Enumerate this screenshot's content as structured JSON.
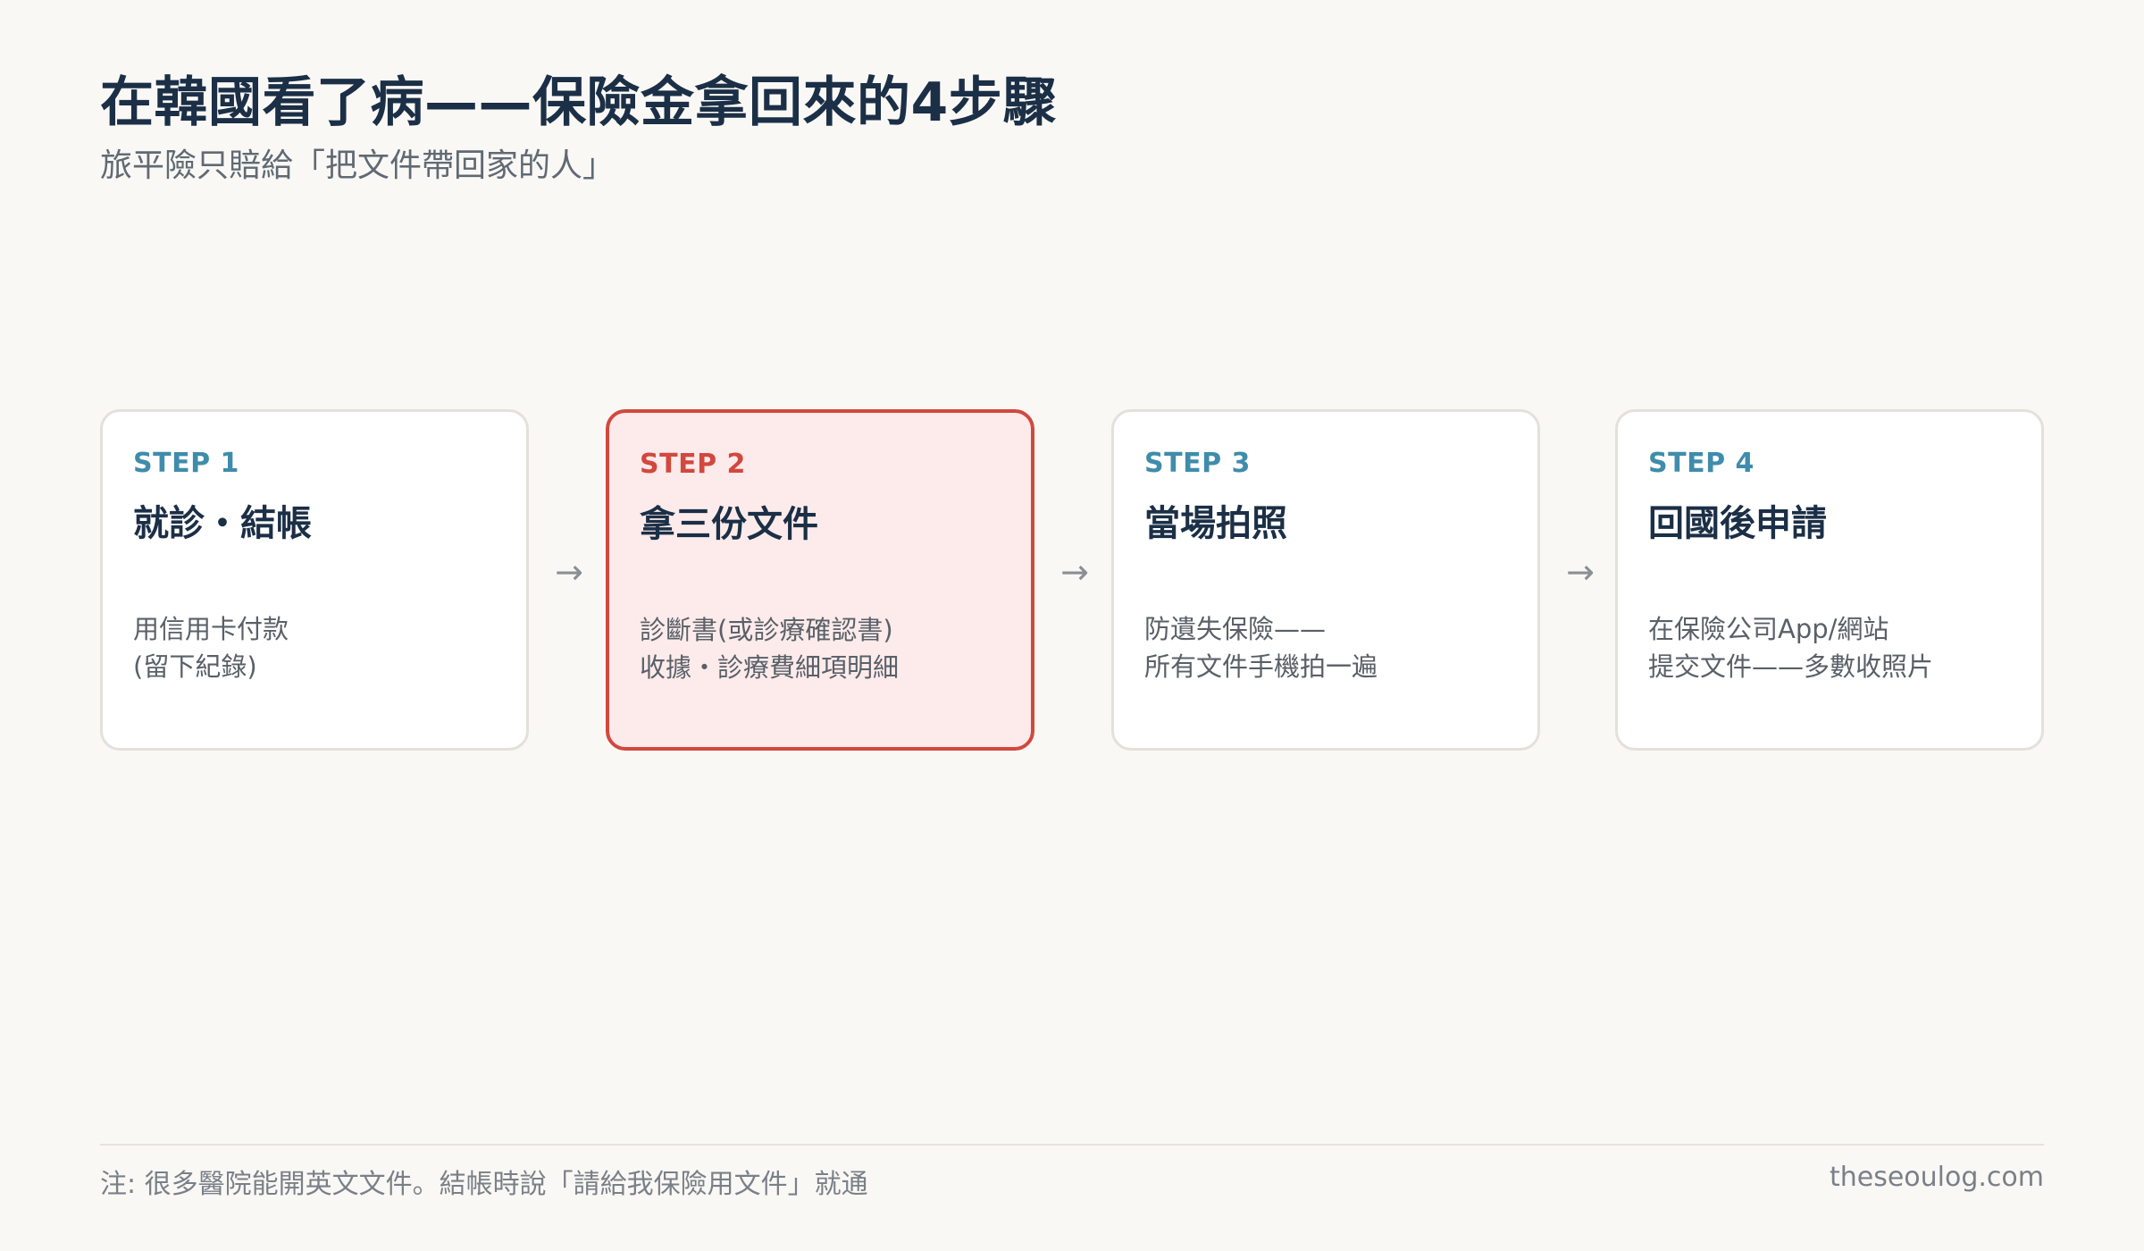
{
  "header": {
    "title": "在韓國看了病——保險金拿回來的4步驟",
    "subtitle": "旅平險只賠給「把文件帶回家的人」"
  },
  "steps": [
    {
      "label": "STEP 1",
      "title": "就診・結帳",
      "desc": [
        "用信用卡付款",
        "(留下紀錄)"
      ],
      "highlight": false
    },
    {
      "label": "STEP 2",
      "title": "拿三份文件",
      "desc": [
        "診斷書(或診療確認書)",
        "收據・診療費細項明細"
      ],
      "highlight": true
    },
    {
      "label": "STEP 3",
      "title": "當場拍照",
      "desc": [
        "防遺失保險——",
        "所有文件手機拍一遍"
      ],
      "highlight": false
    },
    {
      "label": "STEP 4",
      "title": "回國後申請",
      "desc": [
        "在保險公司App/網站",
        "提交文件——多數收照片"
      ],
      "highlight": false
    }
  ],
  "arrow_glyph": "→",
  "footer": {
    "note": "注: 很多醫院能開英文文件。結帳時說「請給我保險用文件」就通",
    "site": "theseoulog.com"
  },
  "colors": {
    "background": "#faf8f5",
    "title": "#1b2f46",
    "step_label": "#3f8cab",
    "highlight_accent": "#d2483e",
    "highlight_fill": "#fcebea"
  }
}
